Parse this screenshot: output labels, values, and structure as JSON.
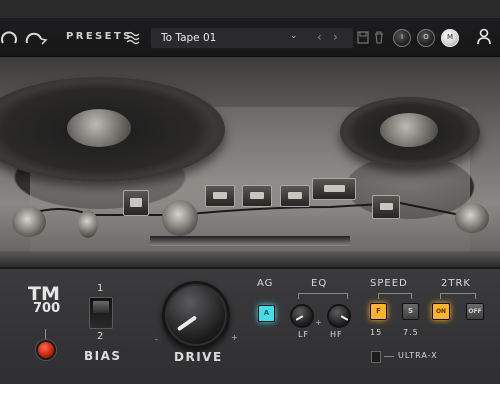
{
  "header": {
    "presets_label": "PRESETS",
    "preset_name": "To Tape 01",
    "icons": [
      "undo-icon",
      "redo-icon",
      "presets-wave-icon",
      "chevron-down-icon",
      "prev-arrow-icon",
      "next-arrow-icon",
      "save-icon",
      "trash-icon",
      "knob-i-icon",
      "knob-o-icon",
      "knob-m-icon",
      "user-icon"
    ],
    "knob_glyphs": [
      "I",
      "O",
      "M"
    ]
  },
  "panel": {
    "logo_main": "TM",
    "logo_sub": "700",
    "bias": {
      "label": "BIAS",
      "pos_top": "1",
      "pos_bottom": "2"
    },
    "drive": {
      "label": "DRIVE",
      "tick_min": "-",
      "tick_max": "+"
    },
    "ag": {
      "label": "AG",
      "button": "A"
    },
    "eq": {
      "label": "EQ",
      "lf": "LF",
      "hf": "HF",
      "minus": "-",
      "plus": "+"
    },
    "speed": {
      "label": "SPEED",
      "fast_button": "F",
      "slow_button": "S",
      "fast_value": "15",
      "slow_value": "7.5"
    },
    "trk2": {
      "label": "2TRK",
      "on": "ON",
      "off": "OFF"
    },
    "ultra_x": "ULTRA-X"
  },
  "colors": {
    "accent_cyan": "#3fe0ea",
    "accent_orange": "#ffb428",
    "power_red": "#e0301a"
  }
}
